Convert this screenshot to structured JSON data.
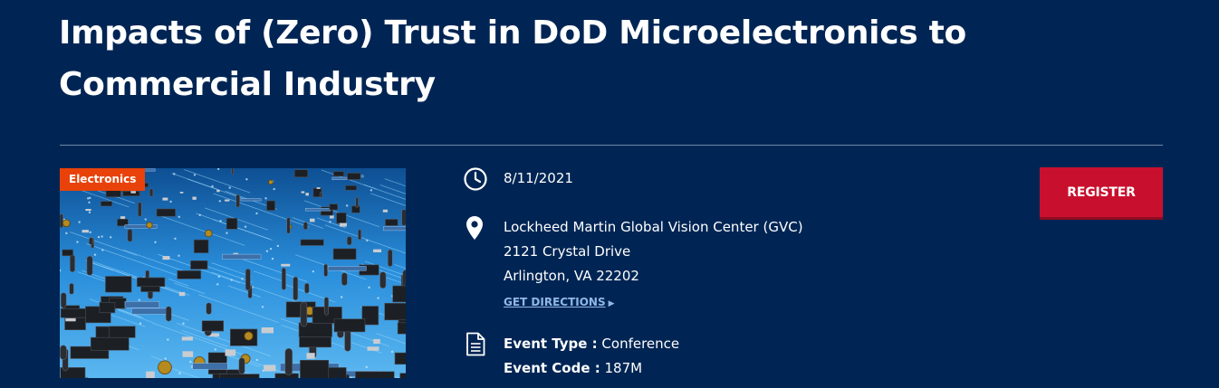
{
  "event": {
    "title": "Impacts of (Zero) Trust in DoD Microelectronics to Commercial Industry",
    "category_tag": "Electronics",
    "date": "8/11/2021",
    "venue": "Lockheed Martin Global Vision Center (GVC)",
    "street": "2121 Crystal Drive",
    "city_state_zip": "Arlington,  VA  22202",
    "directions_label": "GET DIRECTIONS",
    "event_type_label": "Event Type :",
    "event_type_value": "Conference",
    "event_code_label": "Event Code :",
    "event_code_value": "187M",
    "register_label": "REGISTER"
  },
  "icons": {
    "date": "clock-icon",
    "location": "map-pin-icon",
    "details": "document-icon",
    "directions": "triangle-right-icon"
  },
  "colors": {
    "background": "#002554",
    "tag": "#e8420a",
    "register": "#c8102e",
    "link": "#8fb8e8"
  }
}
